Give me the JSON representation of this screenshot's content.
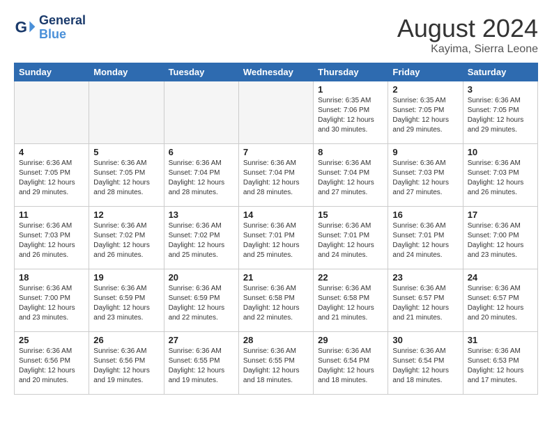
{
  "header": {
    "logo_line1": "General",
    "logo_line2": "Blue",
    "month_year": "August 2024",
    "location": "Kayima, Sierra Leone"
  },
  "weekdays": [
    "Sunday",
    "Monday",
    "Tuesday",
    "Wednesday",
    "Thursday",
    "Friday",
    "Saturday"
  ],
  "weeks": [
    [
      {
        "day": "",
        "empty": true
      },
      {
        "day": "",
        "empty": true
      },
      {
        "day": "",
        "empty": true
      },
      {
        "day": "",
        "empty": true
      },
      {
        "day": "1",
        "sunrise": "6:35 AM",
        "sunset": "7:06 PM",
        "daylight": "12 hours and 30 minutes."
      },
      {
        "day": "2",
        "sunrise": "6:35 AM",
        "sunset": "7:05 PM",
        "daylight": "12 hours and 29 minutes."
      },
      {
        "day": "3",
        "sunrise": "6:36 AM",
        "sunset": "7:05 PM",
        "daylight": "12 hours and 29 minutes."
      }
    ],
    [
      {
        "day": "4",
        "sunrise": "6:36 AM",
        "sunset": "7:05 PM",
        "daylight": "12 hours and 29 minutes."
      },
      {
        "day": "5",
        "sunrise": "6:36 AM",
        "sunset": "7:05 PM",
        "daylight": "12 hours and 28 minutes."
      },
      {
        "day": "6",
        "sunrise": "6:36 AM",
        "sunset": "7:04 PM",
        "daylight": "12 hours and 28 minutes."
      },
      {
        "day": "7",
        "sunrise": "6:36 AM",
        "sunset": "7:04 PM",
        "daylight": "12 hours and 28 minutes."
      },
      {
        "day": "8",
        "sunrise": "6:36 AM",
        "sunset": "7:04 PM",
        "daylight": "12 hours and 27 minutes."
      },
      {
        "day": "9",
        "sunrise": "6:36 AM",
        "sunset": "7:03 PM",
        "daylight": "12 hours and 27 minutes."
      },
      {
        "day": "10",
        "sunrise": "6:36 AM",
        "sunset": "7:03 PM",
        "daylight": "12 hours and 26 minutes."
      }
    ],
    [
      {
        "day": "11",
        "sunrise": "6:36 AM",
        "sunset": "7:03 PM",
        "daylight": "12 hours and 26 minutes."
      },
      {
        "day": "12",
        "sunrise": "6:36 AM",
        "sunset": "7:02 PM",
        "daylight": "12 hours and 26 minutes."
      },
      {
        "day": "13",
        "sunrise": "6:36 AM",
        "sunset": "7:02 PM",
        "daylight": "12 hours and 25 minutes."
      },
      {
        "day": "14",
        "sunrise": "6:36 AM",
        "sunset": "7:01 PM",
        "daylight": "12 hours and 25 minutes."
      },
      {
        "day": "15",
        "sunrise": "6:36 AM",
        "sunset": "7:01 PM",
        "daylight": "12 hours and 24 minutes."
      },
      {
        "day": "16",
        "sunrise": "6:36 AM",
        "sunset": "7:01 PM",
        "daylight": "12 hours and 24 minutes."
      },
      {
        "day": "17",
        "sunrise": "6:36 AM",
        "sunset": "7:00 PM",
        "daylight": "12 hours and 23 minutes."
      }
    ],
    [
      {
        "day": "18",
        "sunrise": "6:36 AM",
        "sunset": "7:00 PM",
        "daylight": "12 hours and 23 minutes."
      },
      {
        "day": "19",
        "sunrise": "6:36 AM",
        "sunset": "6:59 PM",
        "daylight": "12 hours and 23 minutes."
      },
      {
        "day": "20",
        "sunrise": "6:36 AM",
        "sunset": "6:59 PM",
        "daylight": "12 hours and 22 minutes."
      },
      {
        "day": "21",
        "sunrise": "6:36 AM",
        "sunset": "6:58 PM",
        "daylight": "12 hours and 22 minutes."
      },
      {
        "day": "22",
        "sunrise": "6:36 AM",
        "sunset": "6:58 PM",
        "daylight": "12 hours and 21 minutes."
      },
      {
        "day": "23",
        "sunrise": "6:36 AM",
        "sunset": "6:57 PM",
        "daylight": "12 hours and 21 minutes."
      },
      {
        "day": "24",
        "sunrise": "6:36 AM",
        "sunset": "6:57 PM",
        "daylight": "12 hours and 20 minutes."
      }
    ],
    [
      {
        "day": "25",
        "sunrise": "6:36 AM",
        "sunset": "6:56 PM",
        "daylight": "12 hours and 20 minutes."
      },
      {
        "day": "26",
        "sunrise": "6:36 AM",
        "sunset": "6:56 PM",
        "daylight": "12 hours and 19 minutes."
      },
      {
        "day": "27",
        "sunrise": "6:36 AM",
        "sunset": "6:55 PM",
        "daylight": "12 hours and 19 minutes."
      },
      {
        "day": "28",
        "sunrise": "6:36 AM",
        "sunset": "6:55 PM",
        "daylight": "12 hours and 18 minutes."
      },
      {
        "day": "29",
        "sunrise": "6:36 AM",
        "sunset": "6:54 PM",
        "daylight": "12 hours and 18 minutes."
      },
      {
        "day": "30",
        "sunrise": "6:36 AM",
        "sunset": "6:54 PM",
        "daylight": "12 hours and 18 minutes."
      },
      {
        "day": "31",
        "sunrise": "6:36 AM",
        "sunset": "6:53 PM",
        "daylight": "12 hours and 17 minutes."
      }
    ]
  ],
  "labels": {
    "sunrise": "Sunrise:",
    "sunset": "Sunset:",
    "daylight": "Daylight:"
  }
}
